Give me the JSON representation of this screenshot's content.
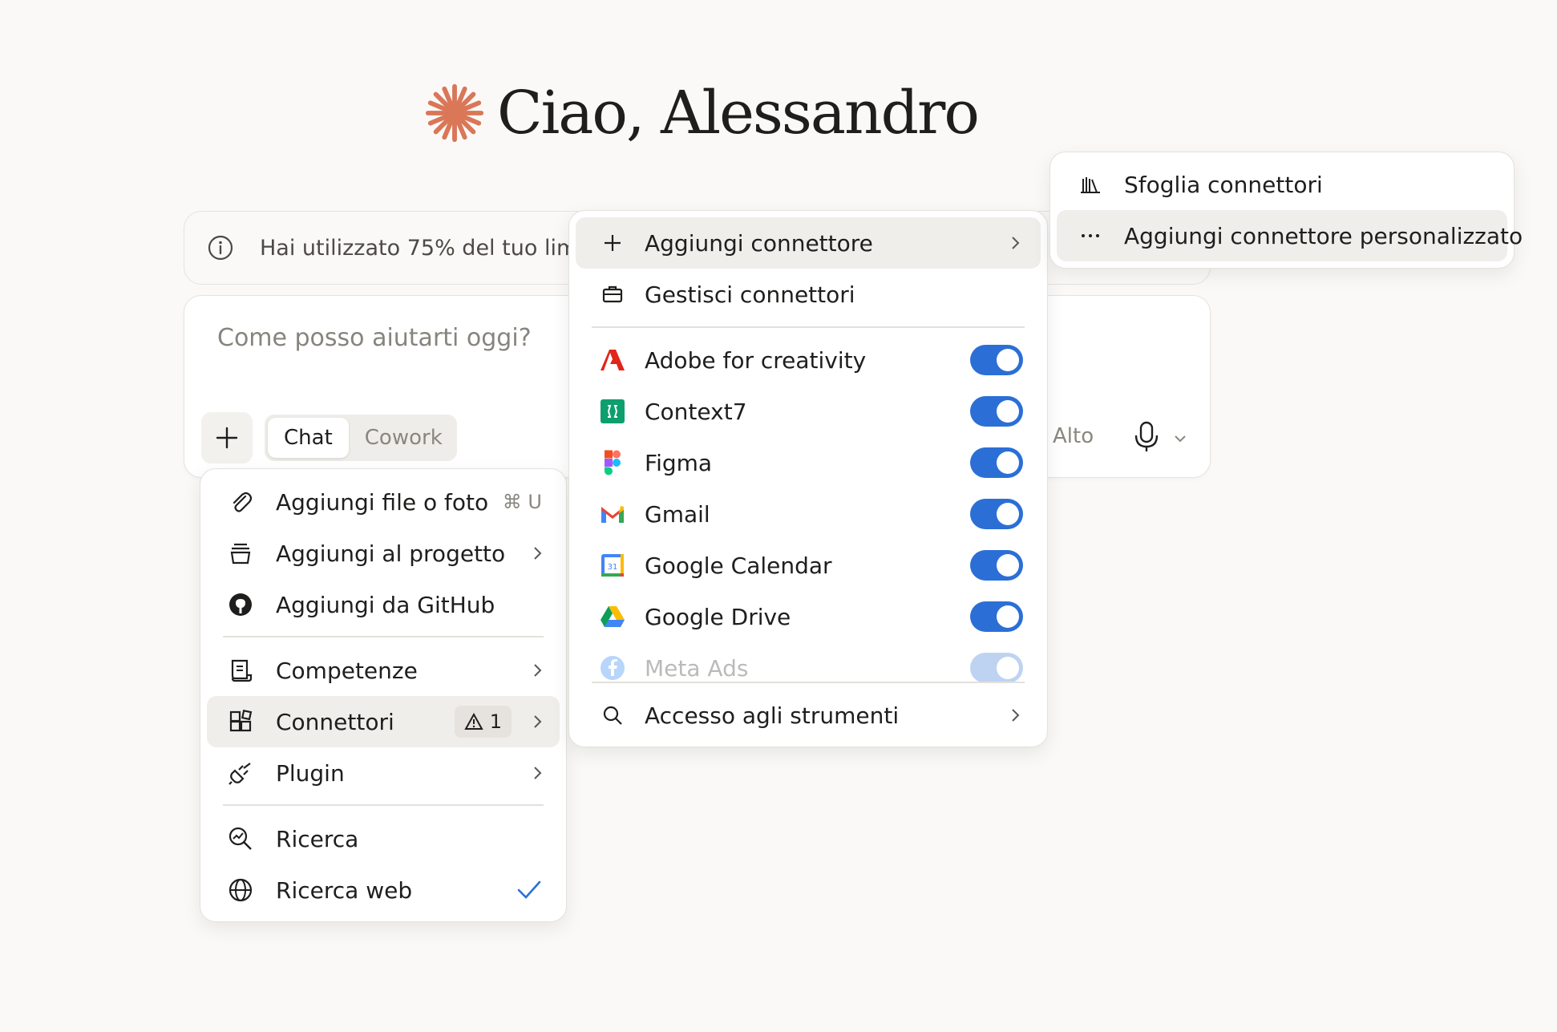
{
  "greeting": {
    "text": "Ciao, Alessandro",
    "accent_color": "#d97757",
    "icon": "sparkle-logo-icon"
  },
  "notice": {
    "icon": "info-icon",
    "text": "Hai utilizzato 75% del tuo limi"
  },
  "composer": {
    "placeholder": "Come posso aiutarti oggi?",
    "plus_icon": "plus-icon",
    "mode_chat": "Chat",
    "mode_cowork": "Cowork",
    "effort_label": "Alto",
    "mic_icon": "microphone-icon"
  },
  "menu_left": {
    "items": [
      {
        "label": "Aggiungi file o foto",
        "icon": "paperclip-icon",
        "shortcut": "⌘ U"
      },
      {
        "label": "Aggiungi al progetto",
        "icon": "project-stack-icon"
      },
      {
        "label": "Aggiungi da GitHub",
        "icon": "github-icon"
      },
      {
        "label": "Competenze",
        "icon": "scroll-icon"
      },
      {
        "label": "Connettori",
        "icon": "connectors-icon",
        "badge": "1"
      },
      {
        "label": "Plugin",
        "icon": "plug-icon"
      },
      {
        "label": "Ricerca",
        "icon": "research-icon"
      },
      {
        "label": "Ricerca web",
        "icon": "globe-icon",
        "checked": true
      }
    ]
  },
  "menu_mid": {
    "add_connector": "Aggiungi connettore",
    "manage_connectors": "Gestisci connettori",
    "connectors": [
      {
        "label": "Adobe for creativity",
        "icon": "adobe-icon",
        "enabled": true,
        "color": "#e1251b"
      },
      {
        "label": "Context7",
        "icon": "context7-icon",
        "enabled": true,
        "color": "#0e9f6e"
      },
      {
        "label": "Figma",
        "icon": "figma-icon",
        "enabled": true
      },
      {
        "label": "Gmail",
        "icon": "gmail-icon",
        "enabled": true
      },
      {
        "label": "Google Calendar",
        "icon": "google-calendar-icon",
        "enabled": true
      },
      {
        "label": "Google Drive",
        "icon": "google-drive-icon",
        "enabled": true
      },
      {
        "label": "Meta Ads",
        "icon": "meta-icon",
        "enabled": true
      }
    ],
    "tool_access": "Accesso agli strumenti",
    "toggle_color": "#2b6fd6"
  },
  "menu_right": {
    "browse": "Sfoglia connettori",
    "custom": "Aggiungi connettore personalizzato"
  }
}
